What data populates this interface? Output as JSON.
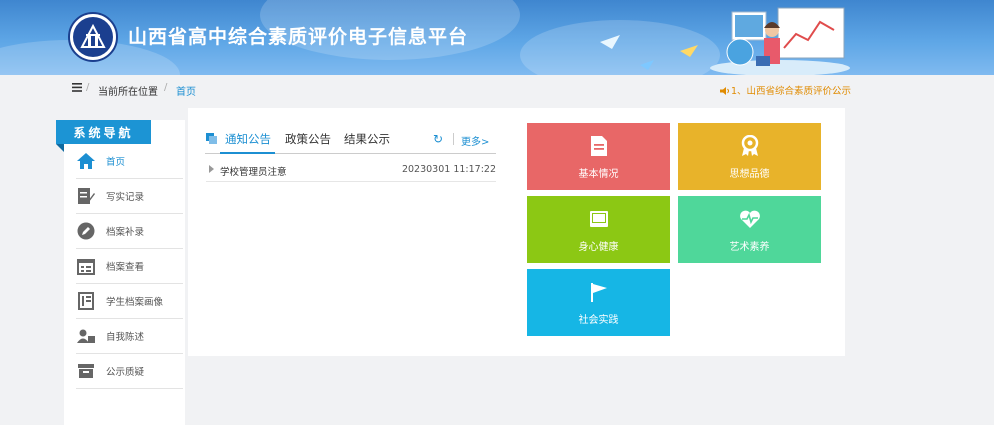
{
  "header": {
    "site_title": "山西省高中综合素质评价电子信息平台"
  },
  "breadcrumb": {
    "location_label": "当前所在位置",
    "separator": "/",
    "current": "首页"
  },
  "marquee": {
    "text": "1、山西省综合素质评价公示"
  },
  "sidebar": {
    "title": "系统导航",
    "items": [
      {
        "label": "首页",
        "icon": "home-icon"
      },
      {
        "label": "写实记录",
        "icon": "edit-record-icon"
      },
      {
        "label": "档案补录",
        "icon": "pencil-circle-icon"
      },
      {
        "label": "档案查看",
        "icon": "calendar-list-icon"
      },
      {
        "label": "学生档案画像",
        "icon": "book-portrait-icon"
      },
      {
        "label": "自我陈述",
        "icon": "user-id-icon"
      },
      {
        "label": "公示质疑",
        "icon": "inbox-icon"
      }
    ]
  },
  "notices": {
    "tabs": [
      "通知公告",
      "政策公告",
      "结果公示"
    ],
    "more_label": "更多>",
    "rows": [
      {
        "title": "学校管理员注意",
        "time": "20230301 11:17:22"
      }
    ]
  },
  "tiles": [
    {
      "label": "基本情况",
      "icon": "document-icon",
      "color": "#e86767"
    },
    {
      "label": "思想品德",
      "icon": "medal-icon",
      "color": "#e8b32a"
    },
    {
      "label": "身心健康",
      "icon": "book-icon",
      "color": "#8cc814"
    },
    {
      "label": "艺术素养",
      "icon": "heart-pulse-icon",
      "color": "#4fd79a"
    },
    {
      "label": "社会实践",
      "icon": "flag-icon",
      "color": "#16b6e5"
    }
  ]
}
